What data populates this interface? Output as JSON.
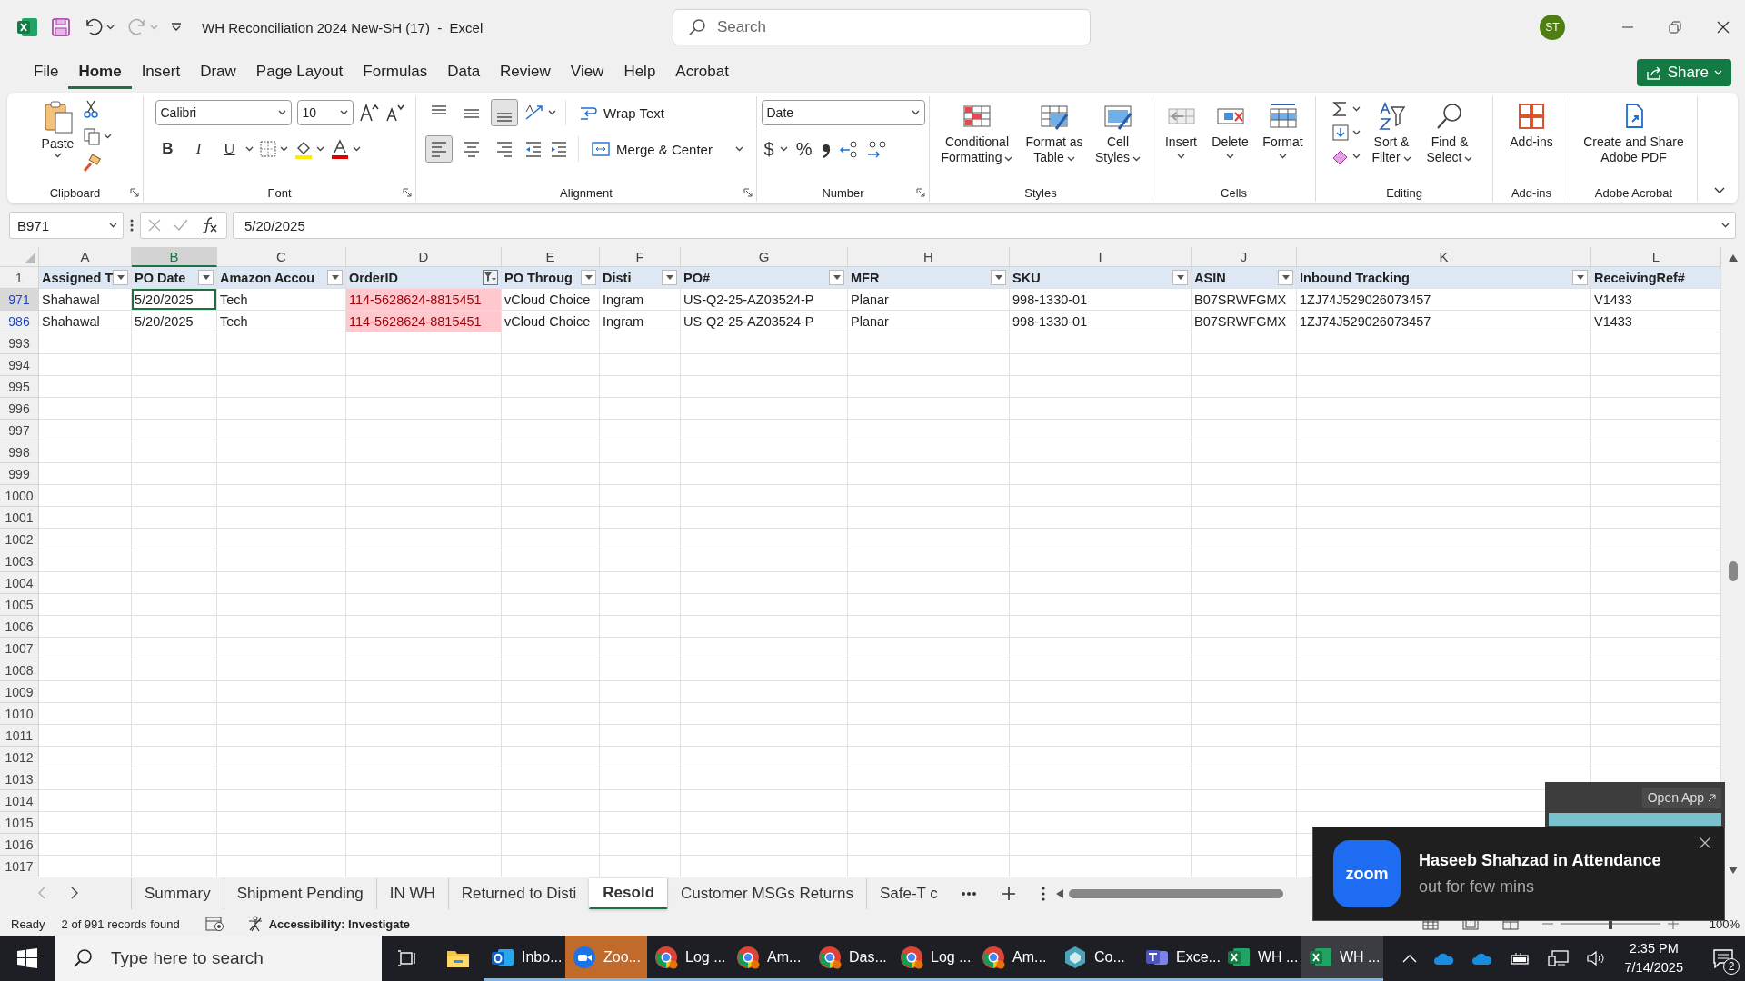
{
  "title_bar": {
    "title": "WH Reconciliation 2024 New-SH (17)  -  Excel",
    "search_placeholder": "Search",
    "user_initials": "ST"
  },
  "menu_tabs": [
    {
      "label": "File",
      "selected": false
    },
    {
      "label": "Home",
      "selected": true
    },
    {
      "label": "Insert",
      "selected": false
    },
    {
      "label": "Draw",
      "selected": false
    },
    {
      "label": "Page Layout",
      "selected": false
    },
    {
      "label": "Formulas",
      "selected": false
    },
    {
      "label": "Data",
      "selected": false
    },
    {
      "label": "Review",
      "selected": false
    },
    {
      "label": "View",
      "selected": false
    },
    {
      "label": "Help",
      "selected": false
    },
    {
      "label": "Acrobat",
      "selected": false
    }
  ],
  "share_button": {
    "label": "Share"
  },
  "ribbon": {
    "groups": [
      {
        "label": "Clipboard",
        "launcher": true,
        "kind": "clipboard",
        "paste": "Paste"
      },
      {
        "label": "Font",
        "launcher": true,
        "kind": "font",
        "font_name": "Calibri",
        "font_size": "10",
        "bold": "B",
        "italic": "I",
        "underline": "U"
      },
      {
        "label": "Alignment",
        "launcher": true,
        "kind": "alignment",
        "wrap": "Wrap Text",
        "merge": "Merge & Center",
        "vertical": [
          {
            "selected": false
          },
          {
            "selected": false
          },
          {
            "selected": true
          }
        ],
        "horizontal": [
          {
            "selected": true
          },
          {
            "selected": false
          },
          {
            "selected": false
          }
        ]
      },
      {
        "label": "Number",
        "launcher": true,
        "kind": "number",
        "format": "Date",
        "currency": "$",
        "percent": "%"
      },
      {
        "label": "Styles",
        "launcher": false,
        "kind": "large",
        "buttons": [
          {
            "label": "Conditional Formatting",
            "kind": "conditional"
          },
          {
            "label": "Format as Table",
            "kind": "table"
          },
          {
            "label": "Cell Styles",
            "kind": "styles"
          }
        ]
      },
      {
        "label": "Cells",
        "launcher": false,
        "kind": "large",
        "buttons": [
          {
            "label": "Insert",
            "kind": "insert"
          },
          {
            "label": "Delete",
            "kind": "delete"
          },
          {
            "label": "Format",
            "kind": "format"
          }
        ]
      },
      {
        "label": "Editing",
        "launcher": false,
        "kind": "editing",
        "buttons": [
          {
            "label": "Sort & Filter",
            "kind": "sort"
          },
          {
            "label": "Find & Select",
            "kind": "find"
          }
        ]
      },
      {
        "label": "Add-ins",
        "launcher": false,
        "kind": "large",
        "buttons": [
          {
            "label": "Add-ins",
            "kind": "addins"
          }
        ]
      },
      {
        "label": "Adobe Acrobat",
        "launcher": false,
        "kind": "large",
        "buttons": [
          {
            "label": "Create and Share Adobe PDF",
            "kind": "pdf"
          }
        ]
      }
    ]
  },
  "formula_bar": {
    "name_box": "B971",
    "formula": "5/20/2025"
  },
  "sheet": {
    "columns": [
      {
        "letter": "A",
        "selected": false
      },
      {
        "letter": "B",
        "selected": true
      },
      {
        "letter": "C",
        "selected": false
      },
      {
        "letter": "D",
        "selected": false
      },
      {
        "letter": "E",
        "selected": false
      },
      {
        "letter": "F",
        "selected": false
      },
      {
        "letter": "G",
        "selected": false
      },
      {
        "letter": "H",
        "selected": false
      },
      {
        "letter": "I",
        "selected": false
      },
      {
        "letter": "J",
        "selected": false
      },
      {
        "letter": "K",
        "selected": false
      },
      {
        "letter": "L",
        "selected": false
      }
    ],
    "rows": [
      {
        "number": "1",
        "matched": false,
        "selected": false,
        "kind": "header",
        "cells": [
          {
            "value": "Assigned T",
            "dropdown": true,
            "filtered": false
          },
          {
            "value": "PO Date",
            "dropdown": true,
            "filtered": false
          },
          {
            "value": "Amazon Accou",
            "dropdown": true,
            "filtered": false
          },
          {
            "value": "OrderID",
            "dropdown": true,
            "filtered": true
          },
          {
            "value": "PO Throug",
            "dropdown": true,
            "filtered": false
          },
          {
            "value": "Disti",
            "dropdown": true,
            "filtered": false
          },
          {
            "value": "PO#",
            "dropdown": true,
            "filtered": false
          },
          {
            "value": "MFR",
            "dropdown": true,
            "filtered": false
          },
          {
            "value": "SKU",
            "dropdown": true,
            "filtered": false
          },
          {
            "value": "ASIN",
            "dropdown": true,
            "filtered": false
          },
          {
            "value": "Inbound Tracking",
            "dropdown": true,
            "filtered": false
          },
          {
            "value": "ReceivingRef#",
            "dropdown": false
          }
        ]
      },
      {
        "number": "971",
        "matched": true,
        "selected": true,
        "kind": "data",
        "cells": [
          {
            "value": "Shahawal",
            "highlight": false,
            "active": false
          },
          {
            "value": "5/20/2025",
            "highlight": false,
            "active": true
          },
          {
            "value": "Tech",
            "highlight": false,
            "active": false
          },
          {
            "value": "114-5628624-8815451",
            "highlight": true,
            "active": false
          },
          {
            "value": "vCloud Choice",
            "highlight": false,
            "active": false
          },
          {
            "value": "Ingram",
            "highlight": false,
            "active": false
          },
          {
            "value": "US-Q2-25-AZ03524-P",
            "highlight": false,
            "active": false
          },
          {
            "value": "Planar",
            "highlight": false,
            "active": false
          },
          {
            "value": "998-1330-01",
            "highlight": false,
            "active": false
          },
          {
            "value": "B07SRWFGMX",
            "highlight": false,
            "active": false
          },
          {
            "value": "1ZJ74J529026073457",
            "highlight": false,
            "active": false
          },
          {
            "value": "V1433",
            "highlight": false,
            "active": false
          }
        ]
      },
      {
        "number": "986",
        "matched": true,
        "selected": false,
        "kind": "data",
        "cells": [
          {
            "value": "Shahawal",
            "highlight": false,
            "active": false
          },
          {
            "value": "5/20/2025",
            "highlight": false,
            "active": false
          },
          {
            "value": "Tech",
            "highlight": false,
            "active": false
          },
          {
            "value": "114-5628624-8815451",
            "highlight": true,
            "active": false
          },
          {
            "value": "vCloud Choice",
            "highlight": false,
            "active": false
          },
          {
            "value": "Ingram",
            "highlight": false,
            "active": false
          },
          {
            "value": "US-Q2-25-AZ03524-P",
            "highlight": false,
            "active": false
          },
          {
            "value": "Planar",
            "highlight": false,
            "active": false
          },
          {
            "value": "998-1330-01",
            "highlight": false,
            "active": false
          },
          {
            "value": "B07SRWFGMX",
            "highlight": false,
            "active": false
          },
          {
            "value": "1ZJ74J529026073457",
            "highlight": false,
            "active": false
          },
          {
            "value": "V1433",
            "highlight": false,
            "active": false
          }
        ]
      },
      {
        "number": "993",
        "matched": false,
        "selected": false,
        "kind": "empty"
      },
      {
        "number": "994",
        "matched": false,
        "selected": false,
        "kind": "empty"
      },
      {
        "number": "995",
        "matched": false,
        "selected": false,
        "kind": "empty"
      },
      {
        "number": "996",
        "matched": false,
        "selected": false,
        "kind": "empty"
      },
      {
        "number": "997",
        "matched": false,
        "selected": false,
        "kind": "empty"
      },
      {
        "number": "998",
        "matched": false,
        "selected": false,
        "kind": "empty"
      },
      {
        "number": "999",
        "matched": false,
        "selected": false,
        "kind": "empty"
      },
      {
        "number": "1000",
        "matched": false,
        "selected": false,
        "kind": "empty"
      },
      {
        "number": "1001",
        "matched": false,
        "selected": false,
        "kind": "empty"
      },
      {
        "number": "1002",
        "matched": false,
        "selected": false,
        "kind": "empty"
      },
      {
        "number": "1003",
        "matched": false,
        "selected": false,
        "kind": "empty"
      },
      {
        "number": "1004",
        "matched": false,
        "selected": false,
        "kind": "empty"
      },
      {
        "number": "1005",
        "matched": false,
        "selected": false,
        "kind": "empty"
      },
      {
        "number": "1006",
        "matched": false,
        "selected": false,
        "kind": "empty"
      },
      {
        "number": "1007",
        "matched": false,
        "selected": false,
        "kind": "empty"
      },
      {
        "number": "1008",
        "matched": false,
        "selected": false,
        "kind": "empty"
      },
      {
        "number": "1009",
        "matched": false,
        "selected": false,
        "kind": "empty"
      },
      {
        "number": "1010",
        "matched": false,
        "selected": false,
        "kind": "empty"
      },
      {
        "number": "1011",
        "matched": false,
        "selected": false,
        "kind": "empty"
      },
      {
        "number": "1012",
        "matched": false,
        "selected": false,
        "kind": "empty"
      },
      {
        "number": "1013",
        "matched": false,
        "selected": false,
        "kind": "empty"
      },
      {
        "number": "1014",
        "matched": false,
        "selected": false,
        "kind": "empty"
      },
      {
        "number": "1015",
        "matched": false,
        "selected": false,
        "kind": "empty"
      },
      {
        "number": "1016",
        "matched": false,
        "selected": false,
        "kind": "empty"
      },
      {
        "number": "1017",
        "matched": false,
        "selected": false,
        "kind": "empty"
      }
    ]
  },
  "sheet_tabs": [
    {
      "label": "Summary",
      "selected": false
    },
    {
      "label": "Shipment Pending",
      "selected": false
    },
    {
      "label": "IN WH",
      "selected": false
    },
    {
      "label": "Returned to Disti",
      "selected": false
    },
    {
      "label": "Resold",
      "selected": true
    },
    {
      "label": "Customer MSGs Returns",
      "selected": false
    },
    {
      "label": "Safe-T c",
      "selected": false
    }
  ],
  "status_bar": {
    "mode": "Ready",
    "records": "2 of 991 records found",
    "accessibility": "Accessibility: Investigate",
    "zoom": "100%",
    "zoom_slider": {
      "level": 0.5
    }
  },
  "mini_window": {
    "button": "Open App"
  },
  "notification": {
    "logo_text": "zoom",
    "title": "Haseeb Shahzad in Attendance",
    "message": "out for few mins"
  },
  "taskbar": {
    "search_placeholder": "Type here to search",
    "apps": [
      {
        "kind": "outlook",
        "label": "Inbo...",
        "flashing": false,
        "selected": false
      },
      {
        "kind": "zoom",
        "label": "Zoo...",
        "flashing": true,
        "selected": false
      },
      {
        "kind": "chrome",
        "label": "Log ...",
        "flashing": false,
        "selected": false
      },
      {
        "kind": "chrome",
        "label": "Am...",
        "flashing": false,
        "selected": false
      },
      {
        "kind": "chrome",
        "label": "Das...",
        "flashing": false,
        "selected": false
      },
      {
        "kind": "chrome",
        "label": "Log ...",
        "flashing": false,
        "selected": false
      },
      {
        "kind": "chrome",
        "label": "Am...",
        "flashing": false,
        "selected": false
      },
      {
        "kind": "diamond",
        "label": "Co...",
        "flashing": false,
        "selected": false
      },
      {
        "kind": "teams",
        "label": "Exce...",
        "flashing": false,
        "selected": false
      },
      {
        "kind": "excel",
        "label": "WH ...",
        "flashing": false,
        "selected": false
      },
      {
        "kind": "excel",
        "label": "WH ...",
        "flashing": false,
        "selected": true
      }
    ],
    "time": "2:35 PM",
    "date": "7/14/2025",
    "notification_count": "2"
  }
}
